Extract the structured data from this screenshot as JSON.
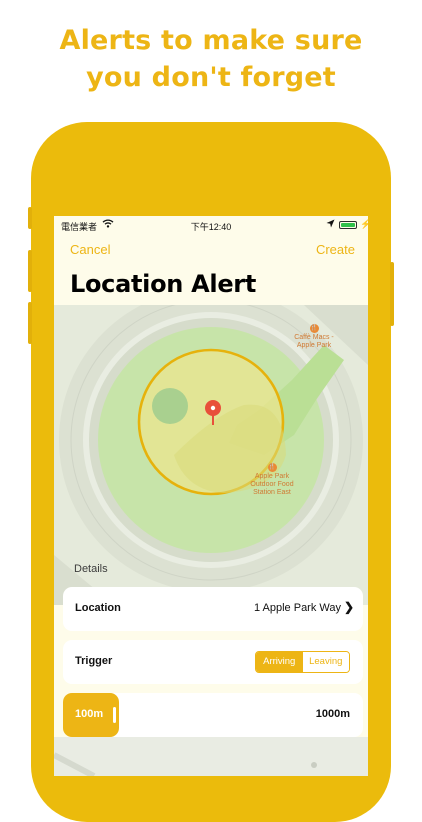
{
  "headline": [
    "Alerts to make sure",
    "you don't forget"
  ],
  "status_bar": {
    "carrier": "電信業者",
    "time": "下午12:40"
  },
  "nav": {
    "cancel": "Cancel",
    "create": "Create"
  },
  "title": "Location Alert",
  "map": {
    "poi_caffe": [
      "Caffè Macs -",
      "Apple Park"
    ],
    "poi_food": [
      "Apple Park",
      "Outdoor Food",
      "Station East"
    ]
  },
  "details": {
    "section_label": "Details",
    "location": {
      "label": "Location",
      "value": "1 Apple Park Way"
    },
    "trigger": {
      "label": "Trigger",
      "options": [
        "Arriving",
        "Leaving"
      ],
      "selected": "Arriving"
    },
    "radius": {
      "min": "100m",
      "max": "1000m",
      "value_fraction": 0.0
    }
  },
  "colors": {
    "accent": "#EDB515",
    "phone": "#EBBB0C",
    "pin": "#E8503A",
    "battery": "#30C04B"
  },
  "icons": [
    "wifi-icon",
    "location-arrow-icon",
    "battery-icon",
    "chevron-right-icon",
    "map-pin-icon",
    "poi-icon"
  ]
}
